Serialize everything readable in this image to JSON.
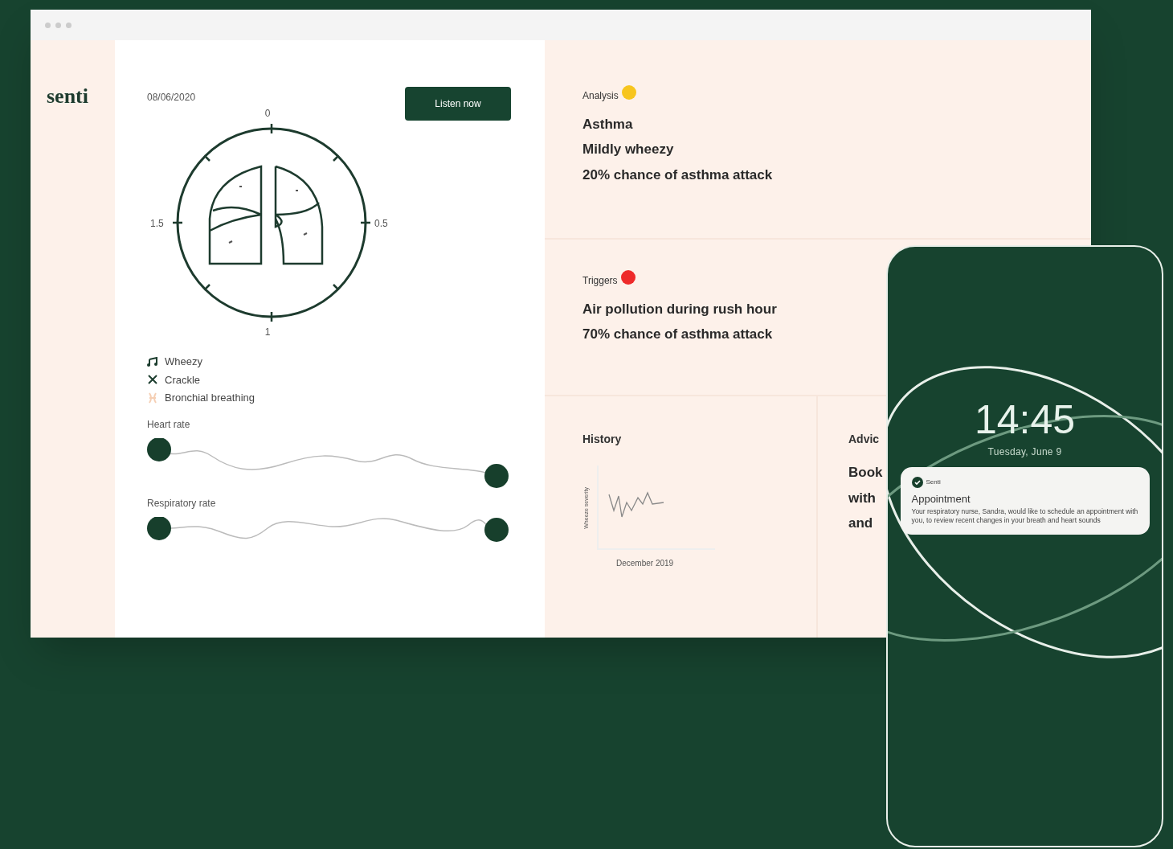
{
  "app": {
    "logo": "senti"
  },
  "scan": {
    "date": "08/06/2020",
    "listen_button": "Listen now",
    "lung_map": {
      "tick_labels": [
        "0",
        "0.5",
        "1",
        "1.5"
      ]
    },
    "legend": [
      {
        "kind": "wheezy",
        "label": "Wheezy",
        "color": "#1c3d2e"
      },
      {
        "kind": "crackle",
        "label": "Crackle",
        "color": "#1c3d2e"
      },
      {
        "kind": "bronchial",
        "label": "Bronchial breathing",
        "color": "#f5cfb4"
      }
    ],
    "vitals": [
      {
        "label": "Heart rate"
      },
      {
        "label": "Respiratory rate"
      }
    ]
  },
  "analysis": {
    "title": "Analysis",
    "color": "#f7c51e",
    "lines": [
      "Asthma",
      "Mildly wheezy",
      "20% chance of asthma attack"
    ]
  },
  "triggers": {
    "title": "Triggers",
    "color": "#ee2a2a",
    "lines": [
      "Air pollution during rush hour",
      "70% chance of asthma attack"
    ]
  },
  "history": {
    "title": "History",
    "ylabel": "Wheeze severity",
    "xlabel": "December 2019"
  },
  "advice": {
    "title": "Advic",
    "lines": [
      "Book",
      "with",
      "and"
    ]
  },
  "phone": {
    "time": "14:45",
    "date": "Tuesday, June 9",
    "notification": {
      "app": "Senti",
      "title": "Appointment",
      "body": "Your respiratory nurse, Sandra, would like to schedule an appointment with you, to review recent changes in your breath and heart sounds"
    }
  }
}
